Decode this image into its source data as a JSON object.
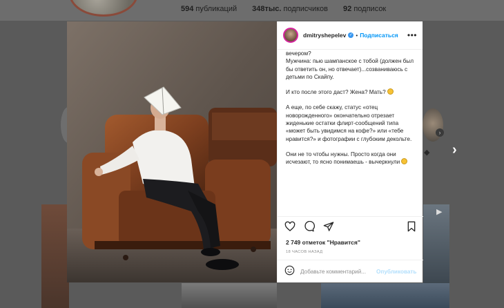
{
  "profile": {
    "posts_count": "594",
    "posts_label": "публикаций",
    "followers_count": "348тыс.",
    "followers_label": "подписчиков",
    "following_count": "92",
    "following_label": "подписок"
  },
  "post": {
    "username": "dmitryshepelev",
    "separator": "•",
    "follow_label": "Подписаться",
    "caption_paragraphs": [
      "вечером?\nМужчина: пью шампанское с тобой (должен был бы ответить он, но отвечает)...созваниваюсь с детьми по Скайпу.",
      "И кто после этого даст? Жена? Мать?",
      "А еще, по себе скажу, статус «отец новорожденного» окончательно отрезает жиденькие остатки флирт-сообщений типа «может быть увидимся на кофе?» или «тебе нравится?» и фотографии с глубоким декольте.",
      "Они не то чтобы нужны. Просто когда они исчезают, то ясно понимаешь - вычеркнули"
    ],
    "likes_text": "2 749 отметок \"Нравится\"",
    "time_ago": "18 ЧАСОВ НАЗАД",
    "comment_placeholder": "Добавьте комментарий...",
    "publish_label": "Опубликовать"
  },
  "icons": {
    "like": "heart-icon",
    "comment": "comment-icon",
    "share": "share-icon",
    "save": "bookmark-icon",
    "emoji": "smiley-icon",
    "more": "more-options-icon",
    "next": "chevron-right-icon"
  },
  "colors": {
    "accent": "#0095f6",
    "verified": "#3897f0",
    "overlay": "#5a5a5a"
  }
}
